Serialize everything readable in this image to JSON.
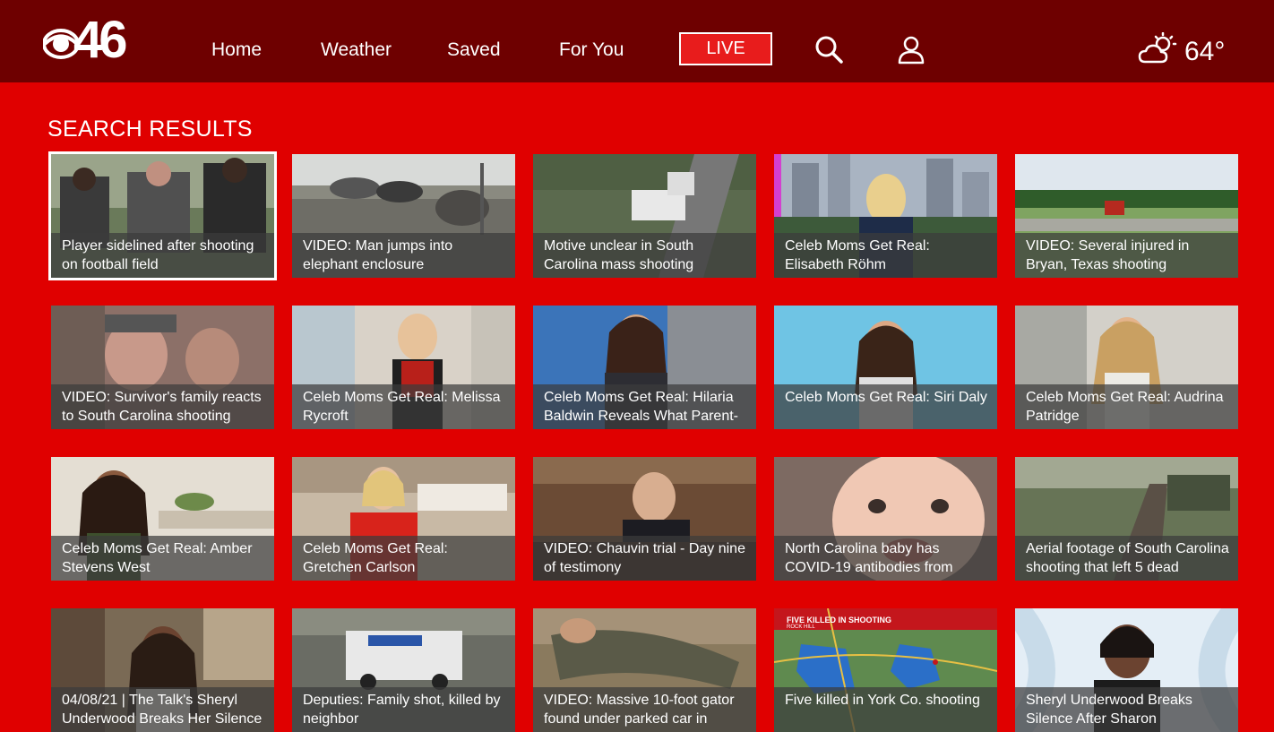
{
  "brand": {
    "logo_text": "46",
    "logo_icon": "cbs-eye-icon"
  },
  "nav": {
    "home": "Home",
    "weather": "Weather",
    "saved": "Saved",
    "for_you": "For You",
    "live": "LIVE",
    "search_icon": "search-icon",
    "account_icon": "user-icon"
  },
  "weather": {
    "icon": "partly-cloudy-sun-icon",
    "temp": "64°"
  },
  "page": {
    "heading": "SEARCH RESULTS"
  },
  "colors": {
    "background": "#e00000",
    "topbar": "#6e0000",
    "live_button": "#e81c1c"
  },
  "results": [
    {
      "title": "Player sidelined after shooting on football field",
      "selected": true
    },
    {
      "title": "VIDEO: Man jumps into elephant enclosure"
    },
    {
      "title": "Motive unclear in South Carolina mass shooting"
    },
    {
      "title": "Celeb Moms Get Real: Elisabeth Röhm"
    },
    {
      "title": "VIDEO: Several injured in Bryan, Texas shooting"
    },
    {
      "title": "VIDEO: Survivor's family reacts to South Carolina shooting"
    },
    {
      "title": "Celeb Moms Get Real: Melissa Rycroft"
    },
    {
      "title": "Celeb Moms Get Real: Hilaria Baldwin Reveals What Parent-"
    },
    {
      "title": "Celeb Moms Get Real: Siri Daly"
    },
    {
      "title": "Celeb Moms Get Real: Audrina Patridge"
    },
    {
      "title": "Celeb Moms Get Real: Amber Stevens West"
    },
    {
      "title": "Celeb Moms Get Real: Gretchen Carlson"
    },
    {
      "title": "VIDEO: Chauvin trial - Day nine of testimony"
    },
    {
      "title": "North Carolina baby has COVID-19 antibodies from"
    },
    {
      "title": "Aerial footage of South Carolina shooting that left 5 dead"
    },
    {
      "title": "04/08/21 | The Talk's Sheryl Underwood Breaks Her Silence +"
    },
    {
      "title": "Deputies: Family shot, killed by neighbor"
    },
    {
      "title": "VIDEO: Massive 10-foot gator found under parked car in"
    },
    {
      "title": "Five killed in York Co. shooting",
      "overlay": "FIVE KILLED IN SHOOTING",
      "overlay_sub": "ROCK HILL"
    },
    {
      "title": "Sheryl Underwood Breaks Silence After Sharon Osbourne's"
    }
  ]
}
